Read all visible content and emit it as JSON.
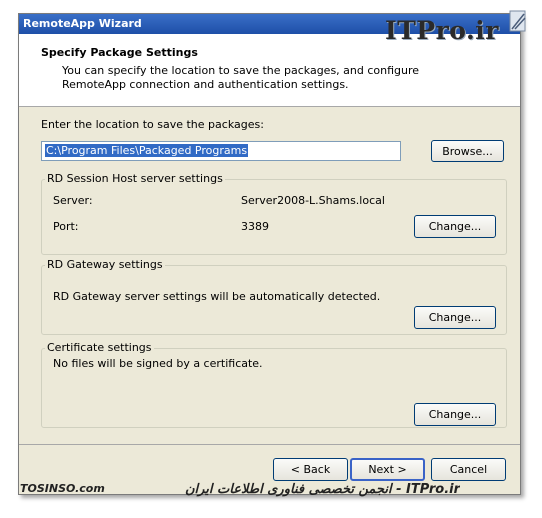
{
  "window": {
    "title": "RemoteApp Wizard"
  },
  "header": {
    "title": "Specify Package Settings",
    "subtitle": "You can specify the location to save the packages, and configure RemoteApp connection and authentication settings."
  },
  "logo": {
    "text": "ITPro.ir"
  },
  "location": {
    "label": "Enter the location to save the packages:",
    "value": "C:\\Program Files\\Packaged Programs",
    "browse_label": "Browse..."
  },
  "rd_session": {
    "title": "RD Session Host server settings",
    "server_label": "Server:",
    "server_value": "Server2008-L.Shams.local",
    "port_label": "Port:",
    "port_value": "3389",
    "change_label": "Change..."
  },
  "rd_gateway": {
    "title": "RD Gateway settings",
    "description": "RD Gateway server settings will be automatically detected.",
    "change_label": "Change..."
  },
  "certificate": {
    "title": "Certificate settings",
    "description": "No files will be signed by a certificate.",
    "change_label": "Change..."
  },
  "footer": {
    "back_label": "< Back",
    "next_label": "Next >",
    "cancel_label": "Cancel"
  },
  "watermark": {
    "left": "TOSINSO.com",
    "right": "ITPro.ir - انجمن تخصصی فناوری اطلاعات ایران"
  }
}
